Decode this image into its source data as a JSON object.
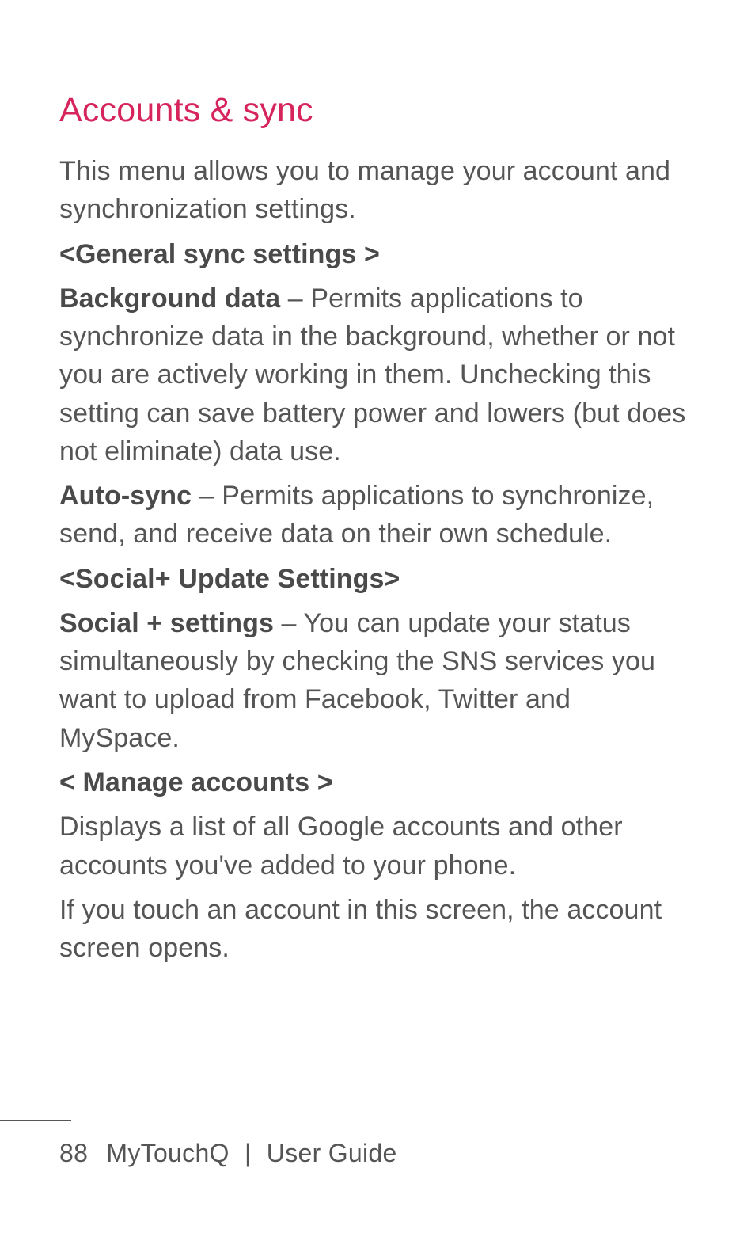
{
  "heading": "Accounts & sync",
  "intro": "This menu allows you to manage your account and synchronization settings.",
  "section1_header": "<General sync settings >",
  "bg_data_bold": "Background data",
  "bg_data_rest": " – Permits applications to synchronize data in the background, whether or not you are actively working in them. Unchecking this setting can save battery power and lowers (but does not eliminate) data use.",
  "autosync_bold": "Auto-sync",
  "autosync_rest": " – Permits applications to synchronize, send, and receive data on their own schedule.",
  "section2_header": "<Social+ Update Settings>",
  "social_bold": "Social + settings",
  "social_rest": " – You can update your status simultaneously by checking the SNS services you want to upload from Facebook, Twitter and MySpace.",
  "section3_header": "< Manage accounts >",
  "manage_p1": "Displays a list of all Google accounts and other accounts you've added to your phone.",
  "manage_p2": "If you touch an account in this screen, the account screen opens.",
  "footer_page": "88",
  "footer_product": "MyTouchQ",
  "footer_sep": "|",
  "footer_doc": "User Guide"
}
